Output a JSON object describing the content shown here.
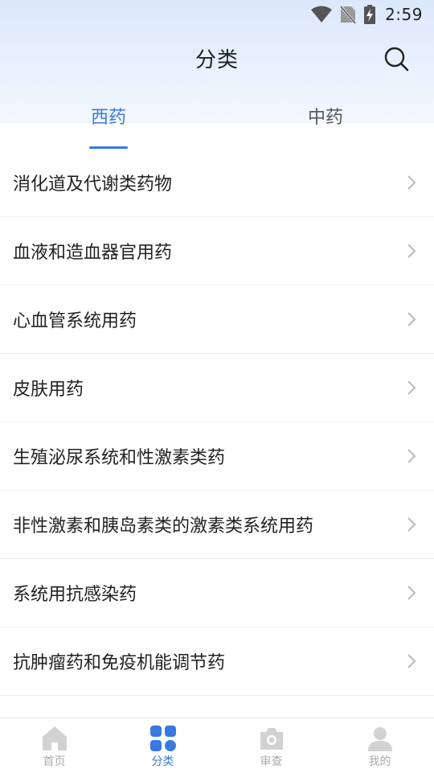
{
  "status_bar": {
    "time": "2:59",
    "icons": [
      "wifi-icon",
      "no-sim-icon",
      "battery-charging-icon"
    ]
  },
  "header": {
    "title": "分类",
    "search_icon": "search-icon"
  },
  "tabs": [
    {
      "label": "西药",
      "active": true
    },
    {
      "label": "中药",
      "active": false
    }
  ],
  "categories": [
    {
      "label": "消化道及代谢类药物"
    },
    {
      "label": "血液和造血器官用药"
    },
    {
      "label": "心血管系统用药"
    },
    {
      "label": "皮肤用药"
    },
    {
      "label": "生殖泌尿系统和性激素类药"
    },
    {
      "label": "非性激素和胰岛素类的激素类系统用药"
    },
    {
      "label": "系统用抗感染药"
    },
    {
      "label": "抗肿瘤药和免疫机能调节药"
    }
  ],
  "bottom_nav": [
    {
      "label": "首页",
      "icon": "home-icon",
      "active": false
    },
    {
      "label": "分类",
      "icon": "category-grid-icon",
      "active": true
    },
    {
      "label": "审查",
      "icon": "camera-icon",
      "active": false
    },
    {
      "label": "我的",
      "icon": "profile-icon",
      "active": false
    }
  ],
  "colors": {
    "accent": "#3a79e0",
    "inactive_nav": "#c8c8c8",
    "header_bg": "#dbe8fb"
  }
}
